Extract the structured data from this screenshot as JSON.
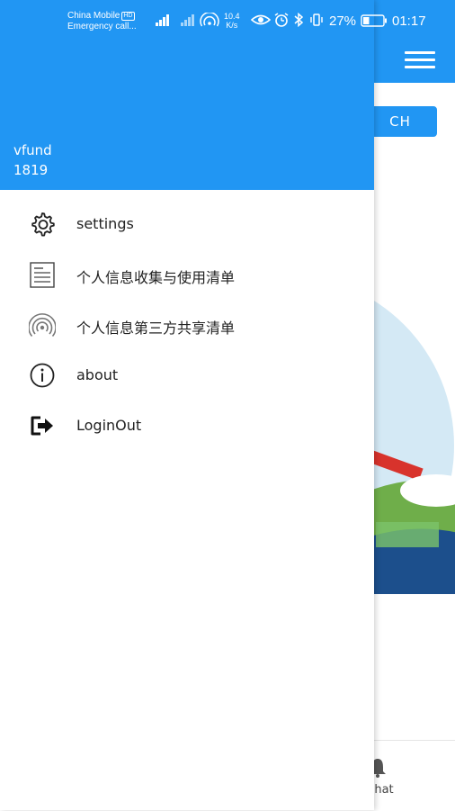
{
  "status_bar": {
    "carrier": "China Mobile",
    "carrier_badge": "HD",
    "carrier_sub": "Emergency call...",
    "net_speed_value": "10.4",
    "net_speed_unit": "K/s",
    "battery": "27%",
    "time": "01:17"
  },
  "drawer": {
    "user_name": "vfund",
    "user_id": "1819",
    "items": [
      {
        "label": "settings",
        "icon": "gear-icon"
      },
      {
        "label": "个人信息收集与使用清单",
        "icon": "document-list-icon"
      },
      {
        "label": "个人信息第三方共享清单",
        "icon": "share-signal-icon"
      },
      {
        "label": "about",
        "icon": "info-icon"
      },
      {
        "label": "LoginOut",
        "icon": "logout-icon"
      }
    ]
  },
  "background": {
    "search_label": "CH",
    "chat_label": "hat"
  },
  "colors": {
    "primary": "#2196f3",
    "text": "#222222"
  }
}
